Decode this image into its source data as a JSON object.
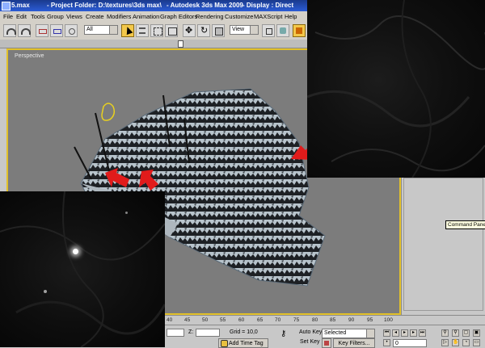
{
  "titlebar": {
    "file": "5.max",
    "project": "- Project Folder: D:\\textures\\3ds max\\",
    "app": "- Autodesk 3ds Max  2009",
    "display": "- Display : Direct"
  },
  "menu": [
    "File",
    "Edit",
    "Tools",
    "Group",
    "Views",
    "Create",
    "Modifiers",
    "Animation",
    "Graph Editors",
    "Rendering",
    "Customize",
    "MAXScript",
    "Help"
  ],
  "toolbar": {
    "selection_filter": "All",
    "reference_coord": "View"
  },
  "viewport": {
    "label": "Perspective"
  },
  "tooltip": "Command Panel",
  "timeline": {
    "ticks": [
      "40",
      "45",
      "50",
      "55",
      "60",
      "65",
      "70",
      "75",
      "80",
      "85",
      "90",
      "95",
      "100"
    ]
  },
  "status": {
    "z_label": "Z:",
    "grid": "Grid = 10,0",
    "auto_key": "Auto Key",
    "auto_key_mode": "Selected",
    "set_key": "Set Key",
    "key_filters": "Key Filters...",
    "add_time_tag": "Add Time Tag",
    "frame": "0"
  },
  "colors": {
    "viewport_border": "#e2c12a",
    "arrow": "#e11b1b",
    "titlebar": "#2b5cd6"
  }
}
